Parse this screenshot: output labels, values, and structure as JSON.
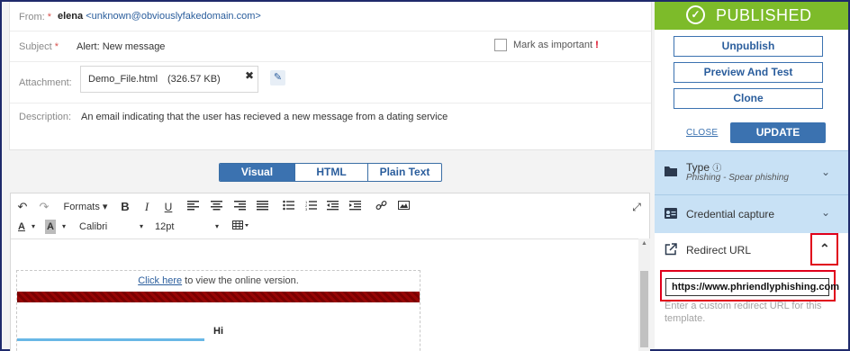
{
  "email": {
    "from_label": "From:",
    "from_name": "elena",
    "from_email": "<unknown@obviouslyfakedomain.com>",
    "subject_label": "Subject",
    "subject_value": "Alert: New message",
    "mark_important_label": "Mark as important",
    "mark_important_mark": "!",
    "attachment_label": "Attachment:",
    "attachment_name": "Demo_File.html",
    "attachment_size": "(326.57 KB)",
    "description_label": "Description:",
    "description_value": "An email indicating that the user has recieved a new message from a dating service"
  },
  "view_toggle": {
    "visual": "Visual",
    "html": "HTML",
    "plain": "Plain Text",
    "active": "Visual"
  },
  "editor": {
    "formats_label": "Formats",
    "font_name": "Calibri",
    "font_size": "12pt",
    "content": {
      "link_text": "Click here",
      "link_suffix": " to view the online version.",
      "greeting": "Hi"
    }
  },
  "panel": {
    "status": "PUBLISHED",
    "status_color": "#7dbb2a",
    "buttons": {
      "unpublish": "Unpublish",
      "preview": "Preview And Test",
      "clone": "Clone"
    },
    "close_label": "CLOSE",
    "update_label": "UPDATE",
    "type": {
      "title": "Type",
      "value": "Phishing - Spear phishing"
    },
    "credential_capture": {
      "title": "Credential capture"
    },
    "redirect": {
      "title": "Redirect URL",
      "value": "https://www.phriendlyphishing.com",
      "help": "Enter a custom redirect URL for this template."
    }
  },
  "highlight_color": "#e0001b",
  "accent_color": "#3b72b0"
}
